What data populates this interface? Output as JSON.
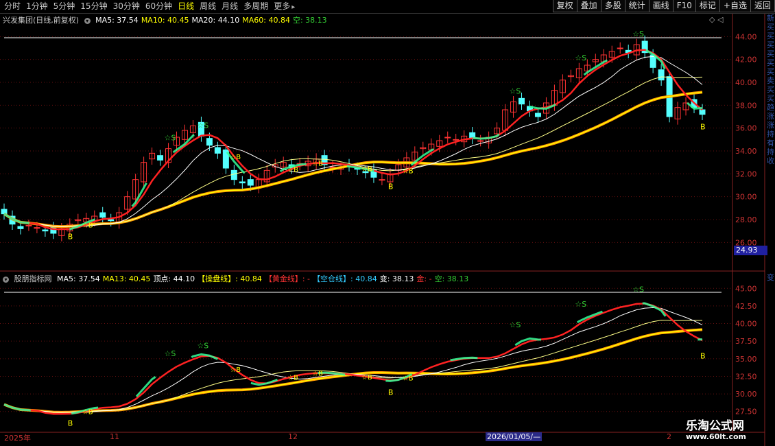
{
  "toolbar": {
    "left": [
      "分时",
      "1分钟",
      "5分钟",
      "15分钟",
      "30分钟",
      "60分钟",
      "日线",
      "周线",
      "月线",
      "多周期",
      "更多"
    ],
    "active_index": 6,
    "right": [
      "复权",
      "叠加",
      "多股",
      "统计",
      "画线",
      "F10",
      "标记",
      "+自选",
      "返回"
    ]
  },
  "main_legend": {
    "title": "兴发集团(日线,前复权)",
    "items": [
      {
        "text": "MA5: 37.54",
        "color": "#ffffff"
      },
      {
        "text": "MA10: 40.45",
        "color": "#ffff00"
      },
      {
        "text": "MA20: 44.10",
        "color": "#ffffff"
      },
      {
        "text": "MA60: 40.84",
        "color": "#ffff00"
      },
      {
        "text": "空: 38.13",
        "color": "#33cc33"
      }
    ]
  },
  "main_tools": "◇ ◁",
  "main_axis_ticks": [
    "44.00",
    "42.00",
    "40.00",
    "38.00",
    "36.00",
    "34.00",
    "32.00",
    "30.00",
    "28.00",
    "26.00"
  ],
  "current_price": "24.93",
  "sub_legend": {
    "title": "股朋指标网",
    "items": [
      {
        "text": "MA5: 37.54",
        "color": "#ffffff"
      },
      {
        "text": "MA13: 40.45",
        "color": "#ffff00"
      },
      {
        "text": "顶点: 44.10",
        "color": "#ffffff"
      },
      {
        "text": "【操盘线】: 40.84",
        "color": "#ffff00"
      },
      {
        "text": "【黄金线】: -",
        "color": "#ff3333"
      },
      {
        "text": "【空仓线】: 40.84",
        "color": "#33ccff"
      },
      {
        "text": "变: 38.13",
        "color": "#ffffff"
      },
      {
        "text": "金: -",
        "color": "#ff3333"
      },
      {
        "text": "空: 38.13",
        "color": "#33cc33"
      }
    ]
  },
  "sub_axis_ticks": [
    "45.00",
    "42.50",
    "40.00",
    "37.50",
    "35.00",
    "32.50",
    "30.00",
    "27.50"
  ],
  "x_labels": [
    {
      "text": "2025年",
      "pos": "start"
    },
    {
      "text": "11",
      "pos": "nov"
    },
    {
      "text": "12",
      "pos": "dec"
    },
    {
      "text": "2",
      "pos": "feb"
    }
  ],
  "x_cursor_date": "2026/01/05/—",
  "side_text_top": "新买买买买买买卖买买趋涨涨持有持收",
  "side_text_bottom": "变",
  "watermark": {
    "line1": "乐淘公式网",
    "line2": "www.60lt.com"
  },
  "signal_labels": {
    "sell": "☆S",
    "buy": "B",
    "star_buy": "☆B"
  },
  "colors": {
    "up": "#ff3333",
    "down": "#54ffff",
    "ma_white": "#ffffff",
    "ma_yellow": "#ffff00",
    "green": "#33cc33"
  },
  "chart_data": {
    "type": "candlestick",
    "price_range": [
      25,
      44.8
    ],
    "closes": [
      28.5,
      27.6,
      27.2,
      27.5,
      27.3,
      27.0,
      26.8,
      27.2,
      27.6,
      28.0,
      28.1,
      28.3,
      28.2,
      27.9,
      28.6,
      30.0,
      31.5,
      33.0,
      33.8,
      33.2,
      34.2,
      35.2,
      35.8,
      36.2,
      35.3,
      34.5,
      33.8,
      32.5,
      31.5,
      31.2,
      31.0,
      31.5,
      32.3,
      32.8,
      33.0,
      32.5,
      32.9,
      33.1,
      33.3,
      32.8,
      32.6,
      32.5,
      32.7,
      32.4,
      32.1,
      31.7,
      31.5,
      32.0,
      32.8,
      33.4,
      33.9,
      34.3,
      34.6,
      34.9,
      35.2,
      35.0,
      35.3,
      35.1,
      34.9,
      35.2,
      36.0,
      37.6,
      38.3,
      38.1,
      37.5,
      37.0,
      38.2,
      39.3,
      40.2,
      40.6,
      41.2,
      41.5,
      42.0,
      42.4,
      42.7,
      43.0,
      42.6,
      43.3,
      42.6,
      41.3,
      40.2,
      37.0,
      37.8,
      38.2,
      37.8,
      37.2
    ],
    "series": [
      {
        "name": "MA5",
        "values": []
      },
      {
        "name": "MA10",
        "values": []
      }
    ]
  }
}
